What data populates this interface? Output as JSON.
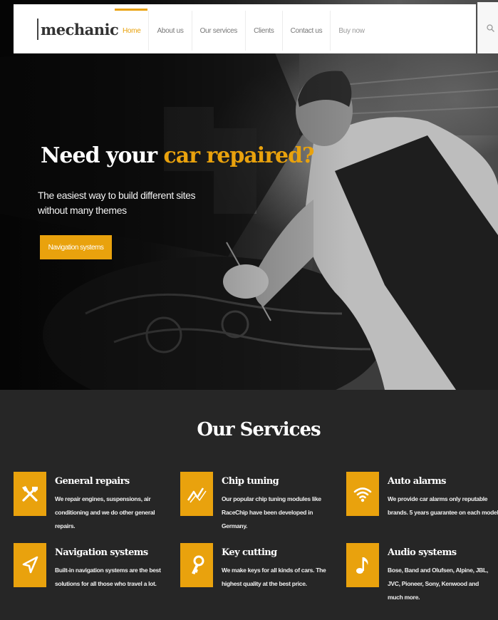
{
  "colors": {
    "accent": "#e9a20d",
    "dark_bg": "#262626",
    "header_bg": "#ffffff"
  },
  "header": {
    "logo": "mechanic",
    "nav": [
      {
        "label": "Home",
        "active": true
      },
      {
        "label": "About us",
        "active": false
      },
      {
        "label": "Our services",
        "active": false
      },
      {
        "label": "Clients",
        "active": false
      },
      {
        "label": "Contact us",
        "active": false
      },
      {
        "label": "Buy now",
        "active": false
      }
    ],
    "search_icon": "search-icon"
  },
  "hero": {
    "title_part1": "Need your",
    "title_part2": "car repaired?",
    "subtitle": "The easiest way to build different sites without many themes",
    "button_label": "Navigation systems",
    "background": "mechanic working under car hood (grayscale photo)"
  },
  "services": {
    "title": "Our Services",
    "items": [
      {
        "title": "General repairs",
        "desc": "We repair engines, suspensions, air conditioning and we do other general repairs.",
        "icon": "wrench-screwdriver-icon"
      },
      {
        "title": "Chip tuning",
        "desc": "Our popular chip tuning modules like RaceChip have been developed in Germany.",
        "icon": "line-chart-icon"
      },
      {
        "title": "Auto alarms",
        "desc": "We provide car alarms only reputable brands. 5 years guarantee on each model.",
        "icon": "wifi-signal-icon"
      },
      {
        "title": "Navigation systems",
        "desc": "Built-in navigation systems are the best solutions for all those who travel a lot.",
        "icon": "navigation-arrow-icon"
      },
      {
        "title": "Key cutting",
        "desc": "We make keys for all kinds of cars. The highest quality at the best price.",
        "icon": "key-icon"
      },
      {
        "title": "Audio systems",
        "desc": "Bose, Band and Olufsen, Alpine, JBL, JVC, Pioneer, Sony, Kenwood and much more.",
        "icon": "music-note-icon"
      }
    ]
  }
}
